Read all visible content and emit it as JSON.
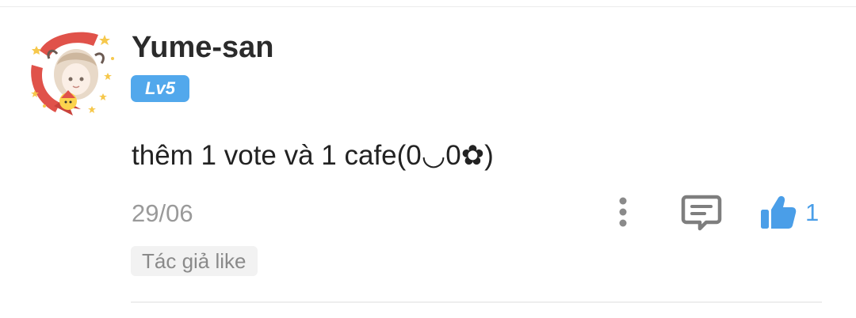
{
  "comment": {
    "username": "Yume-san",
    "level": "Lv5",
    "text": "thêm 1 vote và 1 cafe(0◡0✿)",
    "date": "29/06",
    "like_count": "1",
    "author_like_tag": "Tác giả like"
  },
  "icons": {
    "avatar": "avatar-image",
    "more": "more-vertical-icon",
    "reply": "comment-reply-icon",
    "like": "thumbs-up-icon"
  },
  "colors": {
    "accent_blue": "#52a8ec",
    "like_blue": "#4a9ee8",
    "username": "#2b2b2b",
    "text": "#222222",
    "muted": "#9a9a9a"
  }
}
